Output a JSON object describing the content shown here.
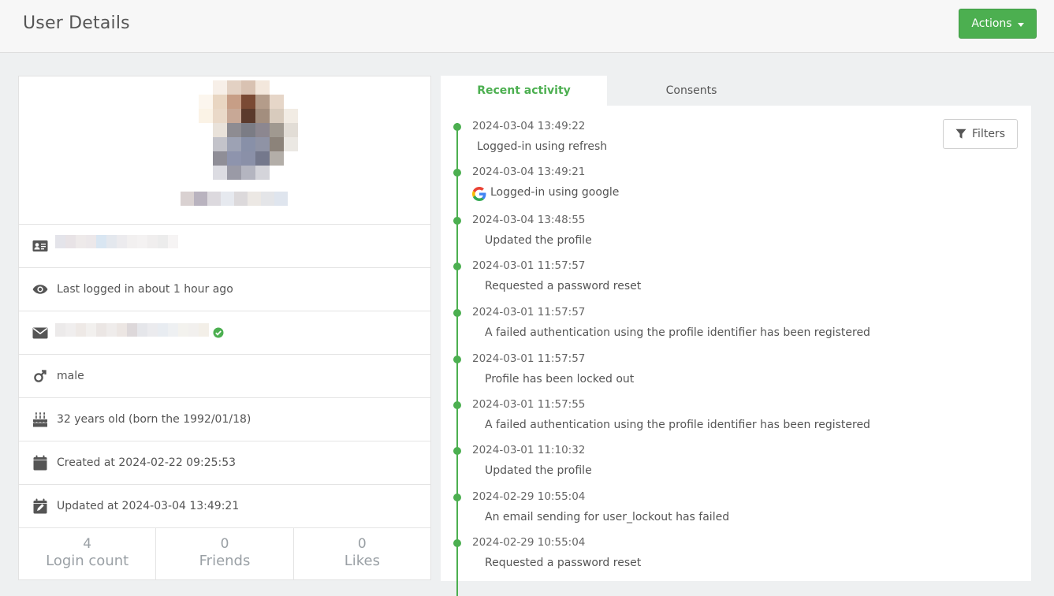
{
  "header": {
    "title": "User Details",
    "actions_label": "Actions"
  },
  "profile": {
    "last_logged": "Last logged in about 1 hour ago",
    "gender": "male",
    "age": "32 years old (born the 1992/01/18)",
    "created": "Created at 2024-02-22 09:25:53",
    "updated": "Updated at 2024-03-04 13:49:21",
    "email_verified_icon": "check-circle-icon",
    "stats": [
      {
        "value": "4",
        "label": "Login count"
      },
      {
        "value": "0",
        "label": "Friends"
      },
      {
        "value": "0",
        "label": "Likes"
      }
    ]
  },
  "tabs": {
    "active": "Recent activity",
    "inactive": "Consents"
  },
  "filters_label": "Filters",
  "activity": [
    {
      "date": "2024-03-04 13:49:22",
      "message": "Logged-in using refresh"
    },
    {
      "date": "2024-03-04 13:49:21",
      "message": "Logged-in using google"
    },
    {
      "date": "2024-03-04 13:48:55",
      "message": "Updated the profile"
    },
    {
      "date": "2024-03-01 11:57:57",
      "message": "Requested a password reset"
    },
    {
      "date": "2024-03-01 11:57:57",
      "message": "A failed authentication using the profile identifier has been registered"
    },
    {
      "date": "2024-03-01 11:57:57",
      "message": "Profile has been locked out"
    },
    {
      "date": "2024-03-01 11:57:55",
      "message": "A failed authentication using the profile identifier has been registered"
    },
    {
      "date": "2024-03-01 11:10:32",
      "message": "Updated the profile"
    },
    {
      "date": "2024-02-29 10:55:04",
      "message": "An email sending for user_lockout has failed"
    },
    {
      "date": "2024-02-29 10:55:04",
      "message": "Requested a password reset"
    }
  ],
  "colors": {
    "accent": "#4caf50",
    "text": "#555555",
    "muted": "#9aa0a5"
  }
}
